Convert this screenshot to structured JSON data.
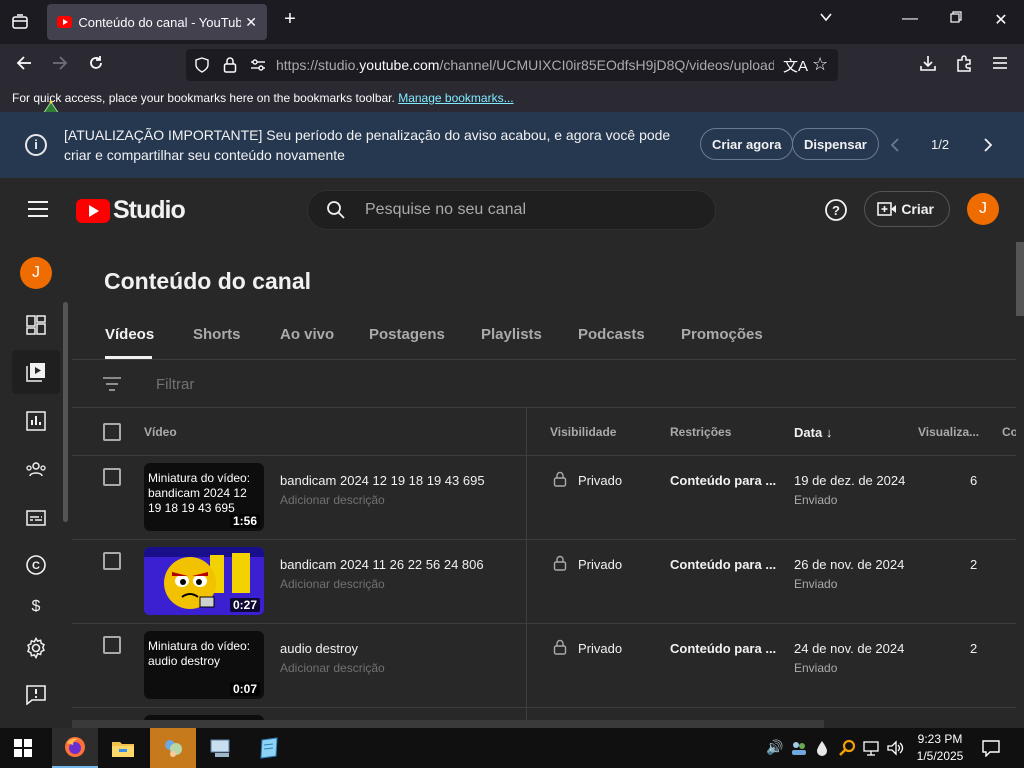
{
  "browser": {
    "tab_title": "Conteúdo do canal - YouTube Studio",
    "url_prefix": "https://studio.",
    "url_domain": "youtube.com",
    "url_rest": "/channel/UCMUIXCI0ir85EOdfsH9jD8Q/videos/upload",
    "bookmarks_text": "For quick access, place your bookmarks here on the bookmarks toolbar.",
    "bookmarks_link": "Manage bookmarks..."
  },
  "announcement": {
    "message": "[ATUALIZAÇÃO IMPORTANTE] Seu período de penalização do aviso acabou, e agora você pode criar e compartilhar seu conteúdo novamente",
    "create_label": "Criar agora",
    "dismiss_label": "Dispensar",
    "pager": "1/2"
  },
  "header": {
    "logo_text": "Studio",
    "search_placeholder": "Pesquise no seu canal",
    "create_label": "Criar",
    "avatar_letter": "J"
  },
  "sidebar": {
    "avatar_letter": "J"
  },
  "main": {
    "title": "Conteúdo do canal",
    "tabs": [
      {
        "label": "Vídeos"
      },
      {
        "label": "Shorts"
      },
      {
        "label": "Ao vivo"
      },
      {
        "label": "Postagens"
      },
      {
        "label": "Playlists"
      },
      {
        "label": "Podcasts"
      },
      {
        "label": "Promoções"
      }
    ],
    "filter_placeholder": "Filtrar",
    "columns": {
      "video": "Vídeo",
      "visibility": "Visibilidade",
      "restrictions": "Restrições",
      "date": "Data",
      "views": "Visualiza...",
      "comments": "Co"
    },
    "rows": [
      {
        "thumb_alt": "Miniatura do vídeo: bandicam 2024 12 19 18 19 43 695",
        "duration": "1:56",
        "title": "bandicam 2024 12 19 18 19 43 695",
        "description": "Adicionar descrição",
        "visibility": "Privado",
        "restrictions": "Conteúdo para ...",
        "date": "19 de dez. de 2024",
        "date_status": "Enviado",
        "views": "6"
      },
      {
        "thumb_alt": "",
        "duration": "0:27",
        "title": "bandicam 2024 11 26 22 56 24 806",
        "description": "Adicionar descrição",
        "visibility": "Privado",
        "restrictions": "Conteúdo para ...",
        "date": "26 de nov. de 2024",
        "date_status": "Enviado",
        "views": "2"
      },
      {
        "thumb_alt": "Miniatura do vídeo: audio destroy",
        "duration": "0:07",
        "title": "audio destroy",
        "description": "Adicionar descrição",
        "visibility": "Privado",
        "restrictions": "Conteúdo para ...",
        "date": "24 de nov. de 2024",
        "date_status": "Enviado",
        "views": "2"
      }
    ]
  },
  "taskbar": {
    "time": "9:23 PM",
    "date": "1/5/2025"
  },
  "colors": {
    "youtube_red": "#ff0000",
    "avatar_orange": "#ef6c00",
    "banner_blue": "#263850",
    "link_cyan": "#80ebff"
  }
}
